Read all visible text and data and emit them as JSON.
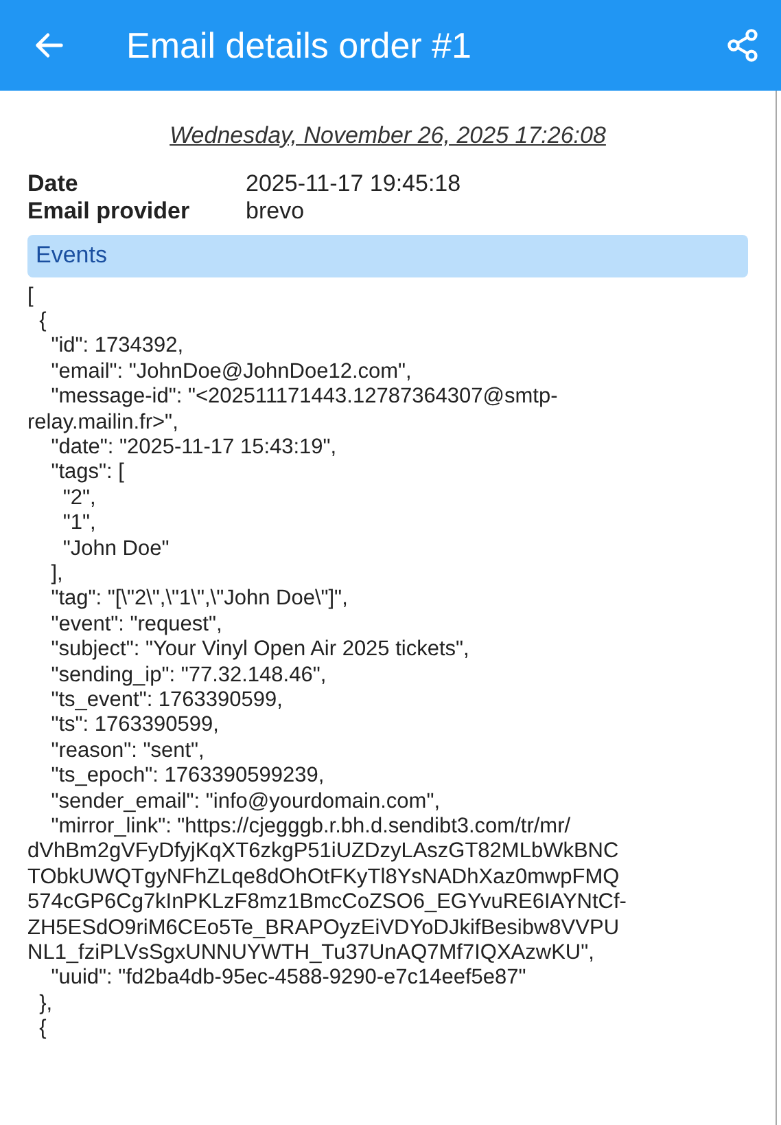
{
  "app_bar": {
    "title": "Email details order #1"
  },
  "timestamp": "Wednesday, November 26, 2025 17:26:08",
  "details": [
    {
      "label": "Date",
      "value": "2025-11-17 19:45:18"
    },
    {
      "label": "Email provider",
      "value": "brevo"
    }
  ],
  "events": {
    "header": "Events",
    "lines": [
      "[",
      "  {",
      "    \"id\": 1734392,",
      "    \"email\": \"JohnDoe@JohnDoe12.com\",",
      "    \"message-id\": \"<202511171443.12787364307@smtp-",
      "relay.mailin.fr>\",",
      "    \"date\": \"2025-11-17 15:43:19\",",
      "    \"tags\": [",
      "      \"2\",",
      "      \"1\",",
      "      \"John Doe\"",
      "    ],",
      "    \"tag\": \"[\\\"2\\\",\\\"1\\\",\\\"John Doe\\\"]\",",
      "    \"event\": \"request\",",
      "    \"subject\": \"Your Vinyl Open Air 2025 tickets\",",
      "    \"sending_ip\": \"77.32.148.46\",",
      "    \"ts_event\": 1763390599,",
      "    \"ts\": 1763390599,",
      "    \"reason\": \"sent\",",
      "    \"ts_epoch\": 1763390599239,",
      "    \"sender_email\": \"info@yourdomain.com\",",
      "    \"mirror_link\": \"https://cjegggb.r.bh.d.sendibt3.com/tr/mr/",
      "dVhBm2gVFyDfyjKqXT6zkgP51iUZDzyLAszGT82MLbWkBNC",
      "TObkUWQTgyNFhZLqe8dOhOtFKyTl8YsNADhXaz0mwpFMQ",
      "574cGP6Cg7kInPKLzF8mz1BmcCoZSO6_EGYvuRE6IAYNtCf-",
      "ZH5ESdO9riM6CEo5Te_BRAPOyzEiVDYoDJkifBesibw8VVPU",
      "NL1_fziPLVsSgxUNNUYWTH_Tu37UnAQ7Mf7IQXAzwKU\",",
      "    \"uuid\": \"fd2ba4db-95ec-4588-9290-e7c14eef5e87\"",
      "  },",
      "  {"
    ]
  }
}
